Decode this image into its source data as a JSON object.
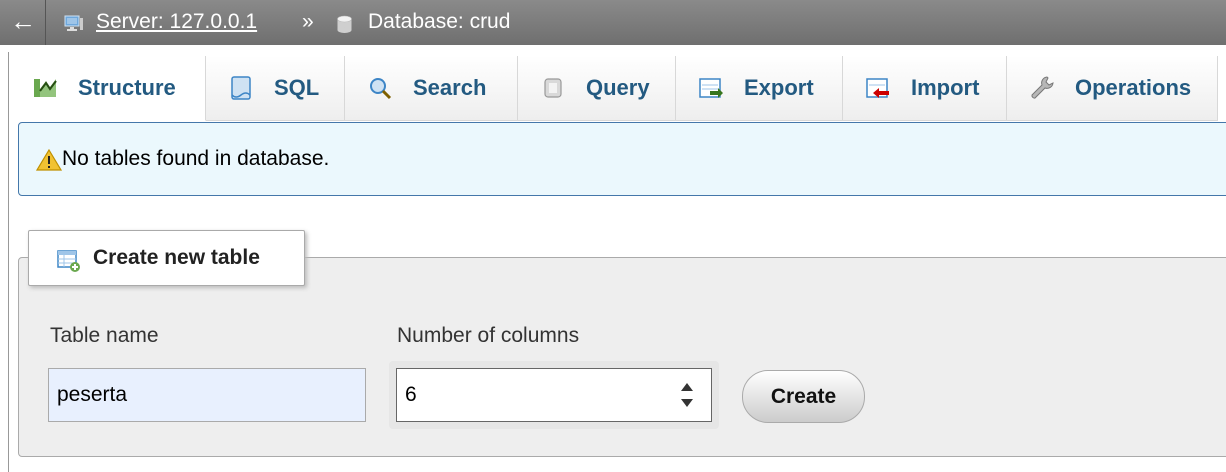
{
  "breadcrumb": {
    "back_glyph": "←",
    "server_link": "Server: 127.0.0.1",
    "separator": "»",
    "database_text": "Database: crud"
  },
  "tabs": [
    {
      "label": "Structure",
      "icon": "structure-icon",
      "active": true
    },
    {
      "label": "SQL",
      "icon": "sql-icon",
      "active": false
    },
    {
      "label": "Search",
      "icon": "search-icon",
      "active": false
    },
    {
      "label": "Query",
      "icon": "query-icon",
      "active": false
    },
    {
      "label": "Export",
      "icon": "export-icon",
      "active": false
    },
    {
      "label": "Import",
      "icon": "import-icon",
      "active": false
    },
    {
      "label": "Operations",
      "icon": "wrench-icon",
      "active": false
    }
  ],
  "notice": {
    "icon": "warning-icon",
    "message": "No tables found in database."
  },
  "create_table": {
    "legend": "Create new table",
    "table_name_label": "Table name",
    "table_name_value": "peserta",
    "columns_label": "Number of columns",
    "columns_value": "6",
    "create_button": "Create"
  },
  "colors": {
    "topbar": "#787878",
    "tab_text": "#235a81",
    "notice_bg": "#ebf8fd",
    "notice_border": "#4477aa",
    "fieldset_bg": "#eeeeee",
    "autofill_bg": "#e8f0fe"
  }
}
